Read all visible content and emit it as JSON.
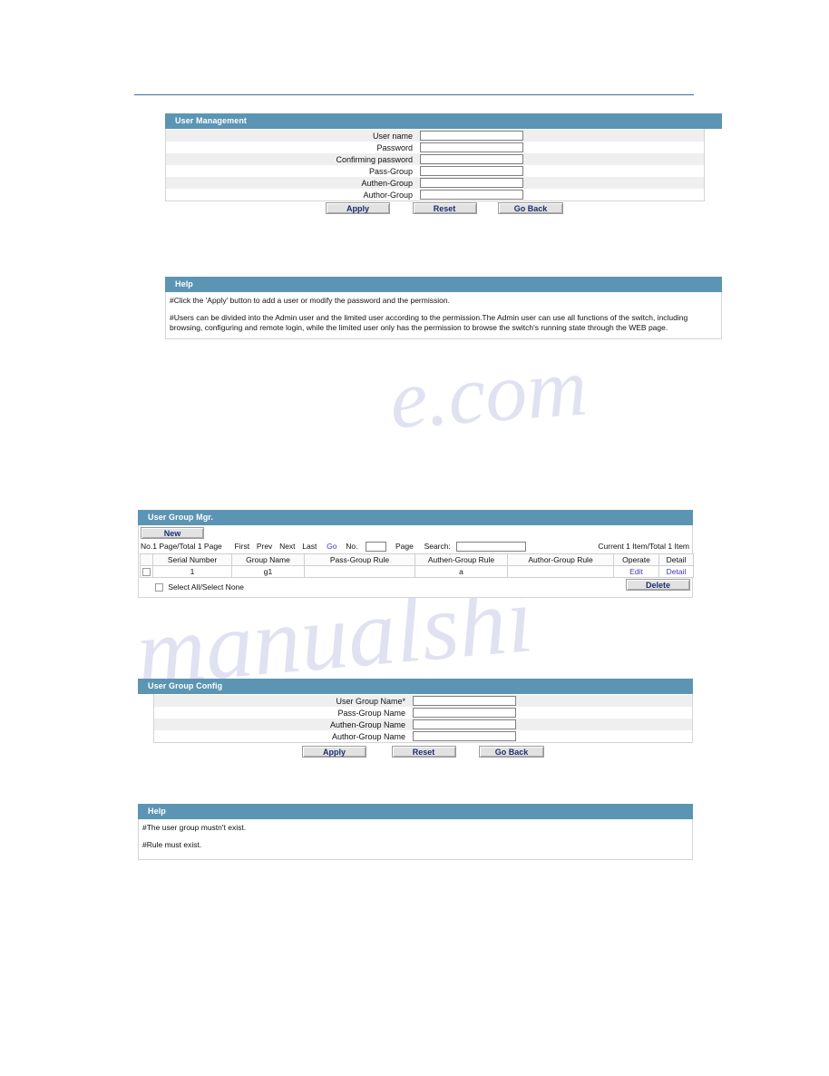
{
  "user_management": {
    "title": "User Management",
    "fields": [
      {
        "label": "User name",
        "value": "",
        "placeholder": ""
      },
      {
        "label": "Password",
        "value": "",
        "placeholder": ""
      },
      {
        "label": "Confirming password",
        "value": "",
        "placeholder": ""
      },
      {
        "label": "Pass-Group",
        "value": "",
        "placeholder": ""
      },
      {
        "label": "Authen-Group",
        "value": "",
        "placeholder": ""
      },
      {
        "label": "Author-Group",
        "value": "",
        "placeholder": ""
      }
    ],
    "buttons": {
      "apply": "Apply",
      "reset": "Reset",
      "go_back": "Go Back"
    }
  },
  "help_top": {
    "title": "Help",
    "lines": [
      "#Click the 'Apply' button to add a user or modify the password and the permission.",
      "#Users can be divided into the Admin user and the limited user according to the permission.The Admin user can use all functions of the switch, including browsing, configuring and remote login, while the limited user only has the permission to browse the switch's running state through the WEB page."
    ]
  },
  "user_group_mgr": {
    "title": "User Group Mgr.",
    "new_button": "New",
    "pager": {
      "page_info": "No.1 Page/Total 1 Page",
      "first": "First",
      "prev": "Prev",
      "next": "Next",
      "last": "Last",
      "go": "Go",
      "no_label": "No.",
      "no_value": "",
      "page_label": "Page",
      "search_label": "Search:",
      "search_value": "",
      "item_info": "Current 1 Item/Total 1 Item"
    },
    "columns": [
      "Serial Number",
      "Group Name",
      "Pass-Group Rule",
      "Authen-Group Rule",
      "Author-Group Rule",
      "Operate",
      "Detail"
    ],
    "rows": [
      {
        "serial_number": "1",
        "group_name": "g1",
        "pass_group_rule": "",
        "authen_group_rule": "a",
        "author_group_rule": "",
        "operate": "Edit",
        "detail": "Detail"
      }
    ],
    "select_all_label": "Select All/Select None",
    "delete_button": "Delete"
  },
  "user_group_config": {
    "title": "User Group Config",
    "fields": [
      {
        "label": "User Group Name*",
        "value": "",
        "placeholder": ""
      },
      {
        "label": "Pass-Group Name",
        "value": "",
        "placeholder": ""
      },
      {
        "label": "Authen-Group Name",
        "value": "",
        "placeholder": ""
      },
      {
        "label": "Author-Group Name",
        "value": "",
        "placeholder": ""
      }
    ],
    "buttons": {
      "apply": "Apply",
      "reset": "Reset",
      "go_back": "Go Back"
    }
  },
  "help_bottom": {
    "title": "Help",
    "lines": [
      "#The user group mustn't exist.",
      "#Rule must exist."
    ]
  },
  "watermark": {
    "text_a": "e.com",
    "text_b": "manualshi"
  },
  "colors": {
    "panel_header": "#5c95b3",
    "rule": "#3f6f8f",
    "link": "#3b37c8",
    "button_text": "#1a2e6e",
    "row_alt": "#efefef"
  }
}
